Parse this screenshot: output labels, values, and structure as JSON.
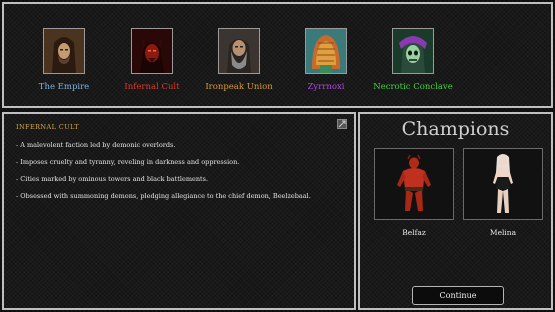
{
  "factions": [
    {
      "name": "The Empire",
      "color": "#7fb2e0",
      "icon": "hooded-emperor-portrait"
    },
    {
      "name": "Infernal Cult",
      "color": "#d83a2a",
      "icon": "demon-portrait"
    },
    {
      "name": "Ironpeak Union",
      "color": "#d89a3a",
      "icon": "bearded-dwarf-portrait"
    },
    {
      "name": "Zyrrnoxi",
      "color": "#b04ae0",
      "icon": "alien-shell-portrait"
    },
    {
      "name": "Necrotic Conclave",
      "color": "#44d244",
      "icon": "skull-lich-portrait"
    }
  ],
  "lore": {
    "title": "INFERNAL CULT",
    "title_color": "#d8a44a",
    "lines": [
      "- A malevolent faction led by demonic overlords.",
      "- Imposes cruelty and tyranny, reveling in darkness and oppression.",
      "- Cities marked by ominous towers and black battlements.",
      "- Obsessed with summoning demons, pledging allegiance to the chief demon, Beelzebaal."
    ]
  },
  "champions": {
    "heading": "Champions",
    "list": [
      {
        "name": "Belfaz",
        "icon": "red-demon-figure"
      },
      {
        "name": "Melina",
        "icon": "pale-woman-figure"
      }
    ],
    "continue_label": "Continue"
  }
}
